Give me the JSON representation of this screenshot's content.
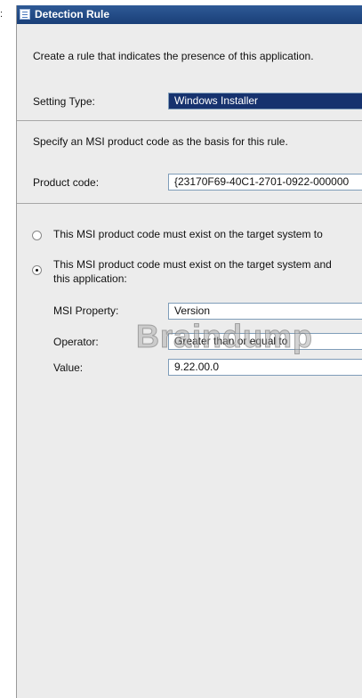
{
  "left_fragment": ":",
  "dialog": {
    "title": "Detection Rule",
    "description": "Create a rule that indicates the presence of this application.",
    "setting_type": {
      "label": "Setting Type:",
      "value": "Windows Installer"
    },
    "msi_instruction": "Specify an MSI product code as the basis for this rule.",
    "product_code": {
      "label": "Product code:",
      "value": "{23170F69-40C1-2701-0922-000000"
    },
    "options": [
      {
        "label": "This MSI product code must exist on the target system to",
        "checked": false
      },
      {
        "label_line1": "This MSI product code must exist on the target system and",
        "label_line2": "this application:",
        "checked": true
      }
    ],
    "msi_property": {
      "label": "MSI Property:",
      "value": "Version"
    },
    "operator": {
      "label": "Operator:",
      "value": "Greater than or equal to"
    },
    "value": {
      "label": "Value:",
      "value": "9.22.00.0"
    }
  },
  "watermark": "Braindump"
}
